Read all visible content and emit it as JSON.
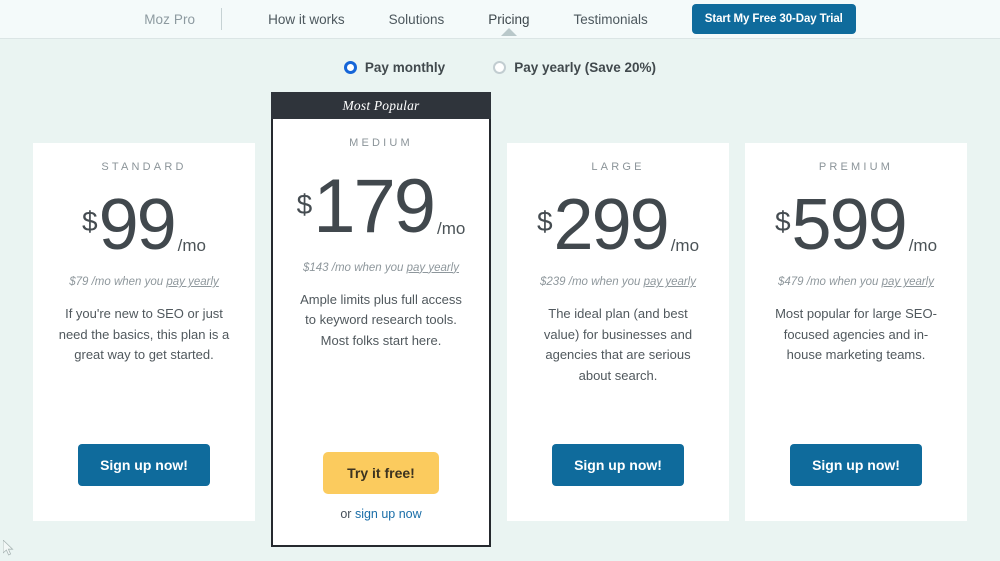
{
  "nav": {
    "brand": "Moz Pro",
    "links": [
      {
        "label": "How it works",
        "active": false
      },
      {
        "label": "Solutions",
        "active": false
      },
      {
        "label": "Pricing",
        "active": true
      },
      {
        "label": "Testimonials",
        "active": false
      }
    ],
    "cta_label": "Start My Free 30-Day Trial",
    "cta_color": "#0f6b9c"
  },
  "billing": {
    "options": [
      {
        "label": "Pay monthly",
        "selected": true
      },
      {
        "label": "Pay yearly (Save 20%)",
        "selected": false
      }
    ],
    "selected_color": "#1565d8"
  },
  "plans": [
    {
      "name": "STANDARD",
      "currency": "$",
      "amount": "99",
      "period": "/mo",
      "yearly_prefix": "$79 /mo when you ",
      "yearly_link": "pay yearly",
      "description": "If you're new to SEO or just need the basics, this plan is a great way to get started.",
      "cta_label": "Sign up now!",
      "featured": false
    },
    {
      "name": "MEDIUM",
      "ribbon": "Most Popular",
      "currency": "$",
      "amount": "179",
      "period": "/mo",
      "yearly_prefix": "$143 /mo when you ",
      "yearly_link": "pay yearly",
      "description": "Ample limits plus full access to keyword research tools. Most folks start here.",
      "cta_label": "Try it free!",
      "alt_prefix": "or ",
      "alt_link": "sign up now",
      "featured": true
    },
    {
      "name": "LARGE",
      "currency": "$",
      "amount": "299",
      "period": "/mo",
      "yearly_prefix": "$239 /mo when you ",
      "yearly_link": "pay yearly",
      "description": "The ideal plan (and best value) for businesses and agencies that are serious about search.",
      "cta_label": "Sign up now!",
      "featured": false
    },
    {
      "name": "PREMIUM",
      "currency": "$",
      "amount": "599",
      "period": "/mo",
      "yearly_prefix": "$479 /mo when you ",
      "yearly_link": "pay yearly",
      "description": "Most popular for large SEO-focused agencies and in-house marketing teams.",
      "cta_label": "Sign up now!",
      "featured": false
    }
  ],
  "theme": {
    "page_bg": "#eaf4f2",
    "nav_bg": "#f4fafa",
    "card_bg": "#ffffff",
    "ribbon_bg": "#2f343b",
    "primary_button": "#0f6b9c",
    "featured_button": "#fbcb5e",
    "link_blue": "#1a6ea8"
  }
}
